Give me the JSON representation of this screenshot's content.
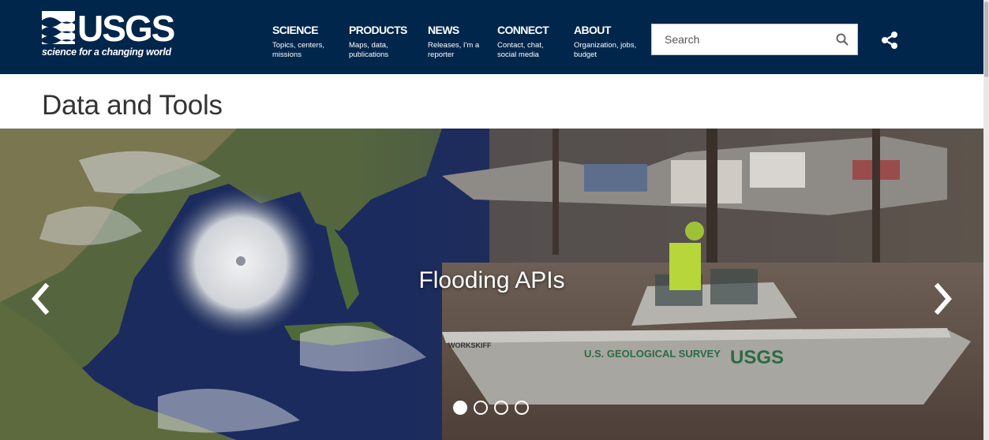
{
  "header": {
    "logo_word": "USGS",
    "logo_tagline": "science for a changing world",
    "nav": [
      {
        "title": "SCIENCE",
        "sub": "Topics, centers, missions"
      },
      {
        "title": "PRODUCTS",
        "sub": "Maps, data, publications"
      },
      {
        "title": "NEWS",
        "sub": "Releases, I'm a reporter"
      },
      {
        "title": "CONNECT",
        "sub": "Contact, chat, social media"
      },
      {
        "title": "ABOUT",
        "sub": "Organization, jobs, budget"
      }
    ],
    "search": {
      "placeholder": "Search",
      "value": ""
    },
    "share_icon": "share-icon"
  },
  "page": {
    "title": "Data and Tools"
  },
  "carousel": {
    "caption": "Flooding APIs",
    "slide_count": 4,
    "active_slide": 1,
    "prev_icon": "chevron-left-icon",
    "next_icon": "chevron-right-icon",
    "boat_text": {
      "hull_label": "U.S. GEOLOGICAL SURVEY",
      "logo": "USGS",
      "brand": "WORKSKIFF"
    }
  },
  "colors": {
    "header_bg": "#00264c",
    "title_text": "#333333",
    "accent": "#ffffff"
  }
}
